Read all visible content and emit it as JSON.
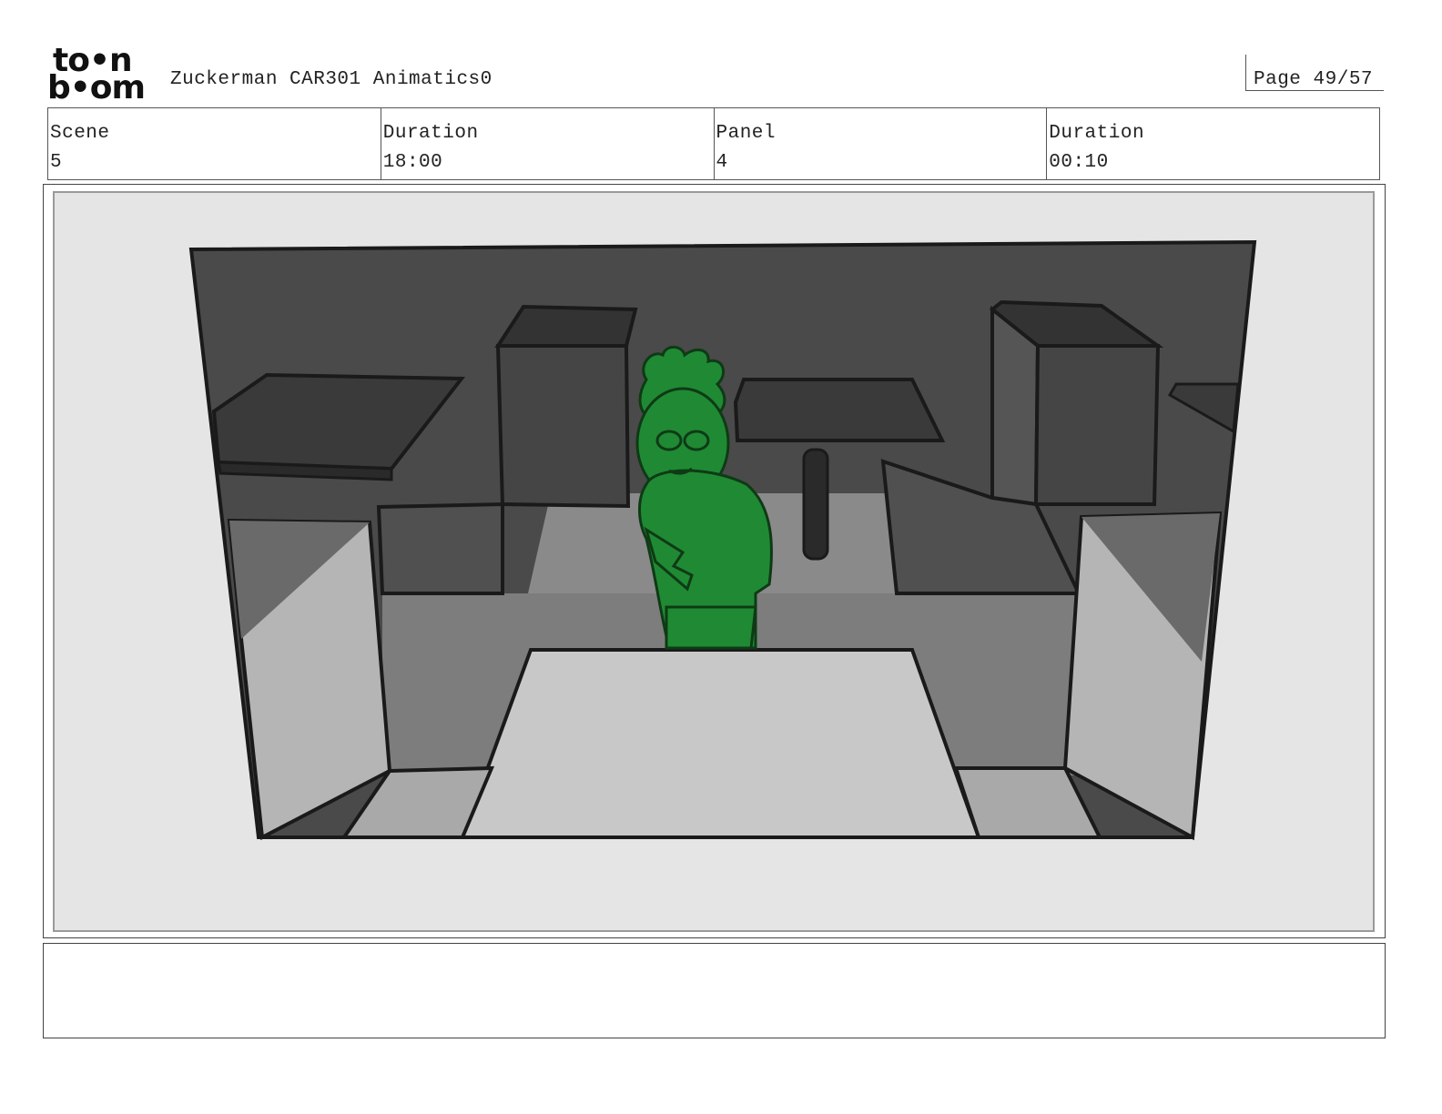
{
  "header": {
    "logo_top": "to•n",
    "logo_bottom": "b•om",
    "title": "Zuckerman CAR301 Animatics0",
    "page": "Page 49/57"
  },
  "info": [
    {
      "label": "Scene",
      "value": "5"
    },
    {
      "label": "Duration",
      "value": "18:00"
    },
    {
      "label": "Panel",
      "value": "4"
    },
    {
      "label": "Duration",
      "value": "00:10"
    }
  ],
  "notes": {
    "text": ""
  },
  "colors": {
    "character": "#1f8a33",
    "wall": "#4a4a4a",
    "floor": "#7d7d7d",
    "frame_bg": "#e5e5e5"
  }
}
